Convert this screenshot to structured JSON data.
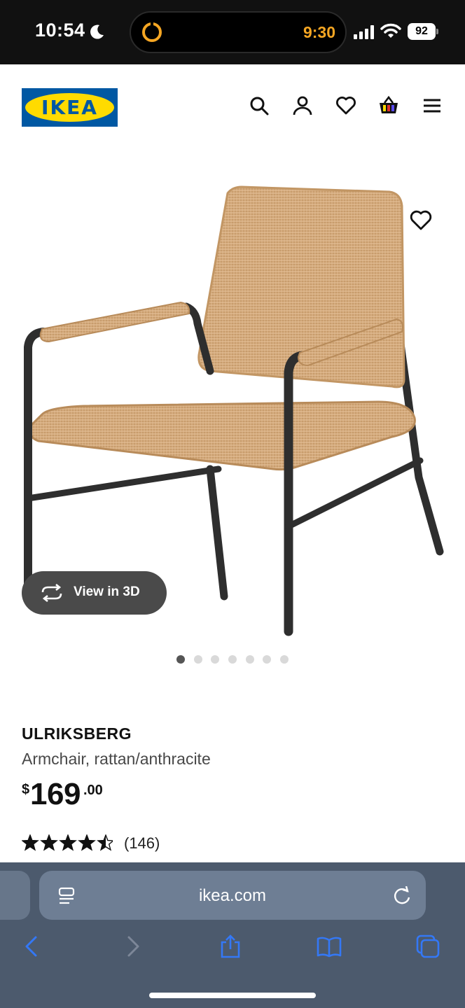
{
  "status_bar": {
    "time": "10:54",
    "timer_time": "9:30",
    "battery": "92",
    "icons": [
      "moon-icon",
      "timer-icon",
      "cellular-signal-icon",
      "wifi-icon",
      "battery-icon"
    ],
    "timer_color": "#f5a623"
  },
  "header": {
    "logo_text": "IKEA",
    "icons": [
      "search-icon",
      "account-icon",
      "wishlist-heart-icon",
      "shopping-basket-icon",
      "menu-icon"
    ],
    "brand_blue": "#0058a3",
    "brand_yellow": "#ffdb00"
  },
  "gallery": {
    "view_3d_label": "View in 3D",
    "image_count": 7,
    "active_image": 1
  },
  "product": {
    "name": "ULRIKSBERG",
    "description": "Armchair, rattan/anthracite",
    "price_currency": "$",
    "price_integer": "169",
    "price_decimal": ".00",
    "rating": 4.5,
    "rating_max": 5,
    "review_count": "(146)"
  },
  "browser": {
    "url": "ikea.com",
    "icons": [
      "reader-mode-icon",
      "reload-icon",
      "back-icon",
      "forward-icon",
      "share-icon",
      "bookmarks-icon",
      "tabs-icon"
    ],
    "accent": "#3478f6"
  }
}
